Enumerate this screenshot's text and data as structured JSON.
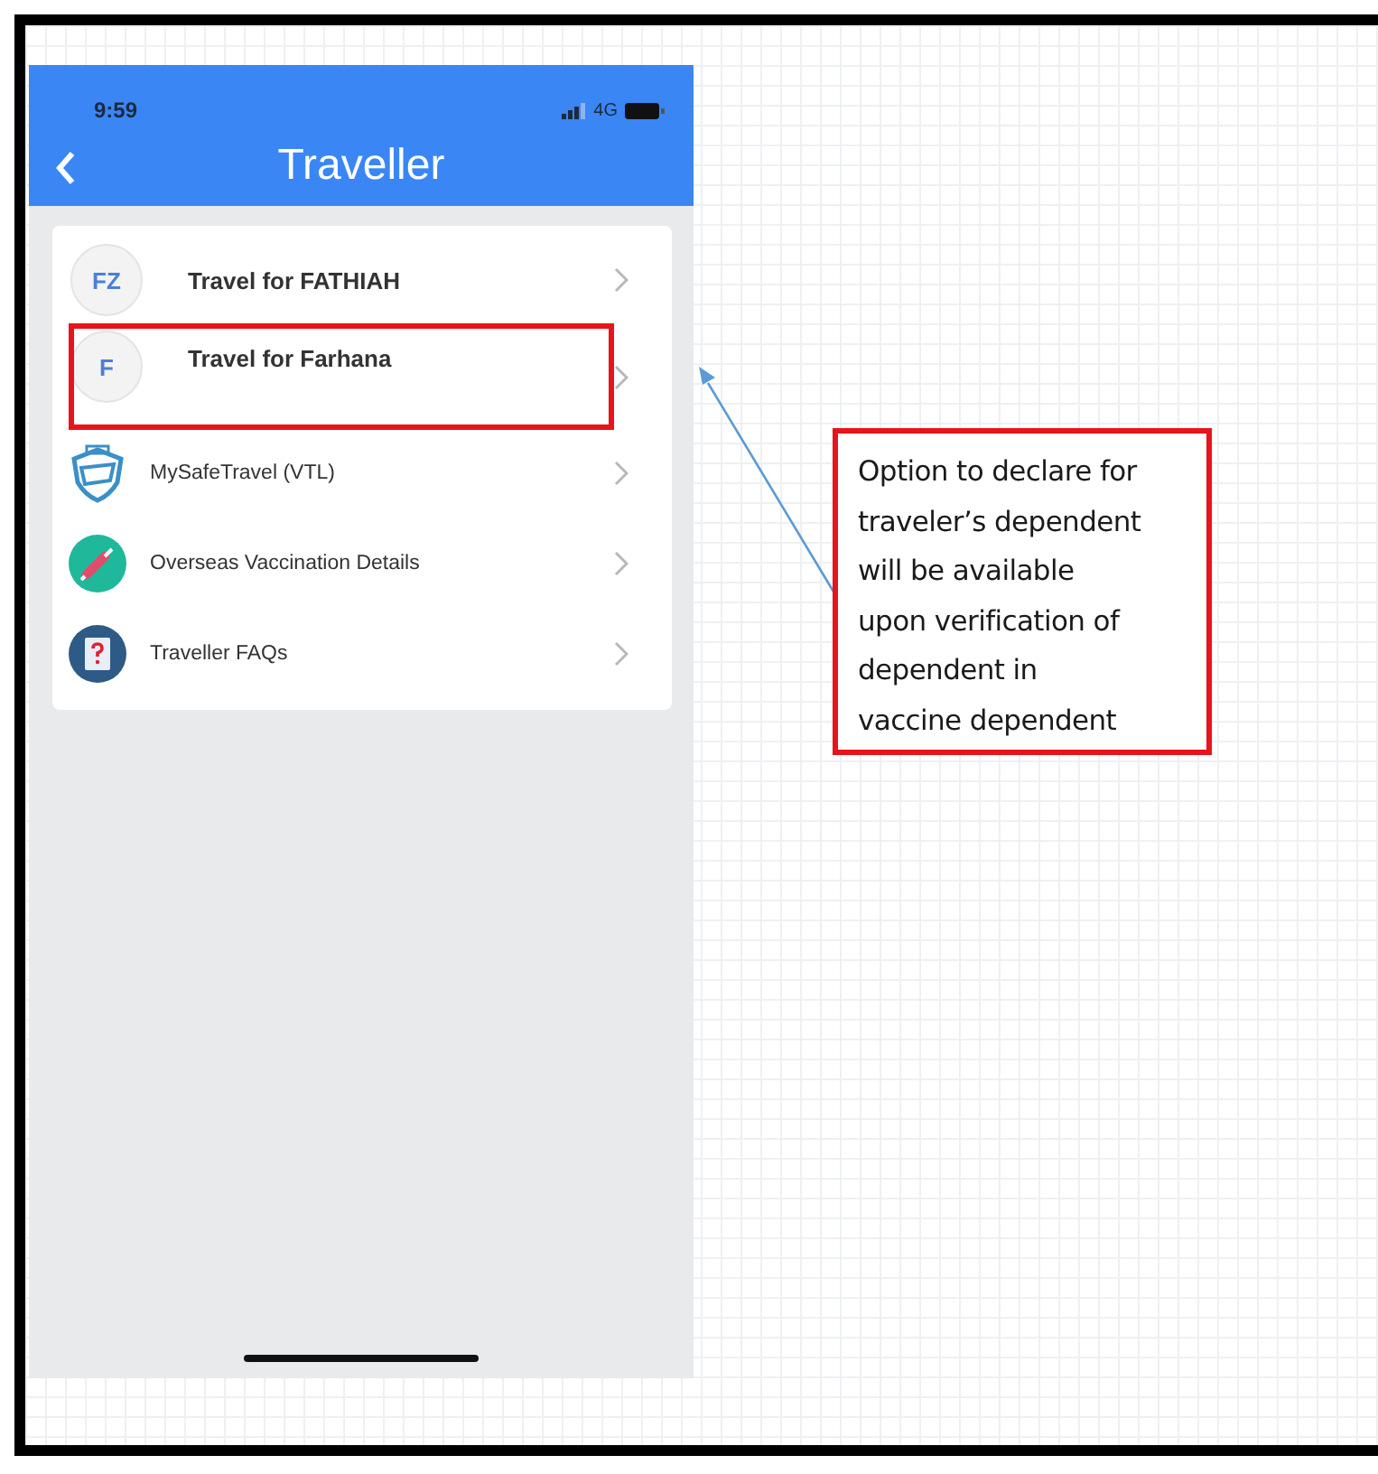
{
  "status_bar": {
    "time": "9:59",
    "network": "4G"
  },
  "header": {
    "title": "Traveller"
  },
  "menu": [
    {
      "kind": "avatar",
      "initials": "FZ",
      "label": "Travel for FATHIAH",
      "highlighted": false
    },
    {
      "kind": "avatar",
      "initials": "F",
      "label": "Travel for Farhana",
      "highlighted": true
    },
    {
      "kind": "shield",
      "label": "MySafeTravel (VTL)",
      "highlighted": false
    },
    {
      "kind": "vaccine",
      "label": "Overseas Vaccination Details",
      "highlighted": false
    },
    {
      "kind": "faq",
      "label": "Traveller FAQs",
      "highlighted": false
    }
  ],
  "callout": {
    "lines": [
      "Option to declare for",
      "traveler’s dependent",
      "will be available",
      "upon verification of",
      "dependent  in",
      "vaccine dependent"
    ]
  }
}
